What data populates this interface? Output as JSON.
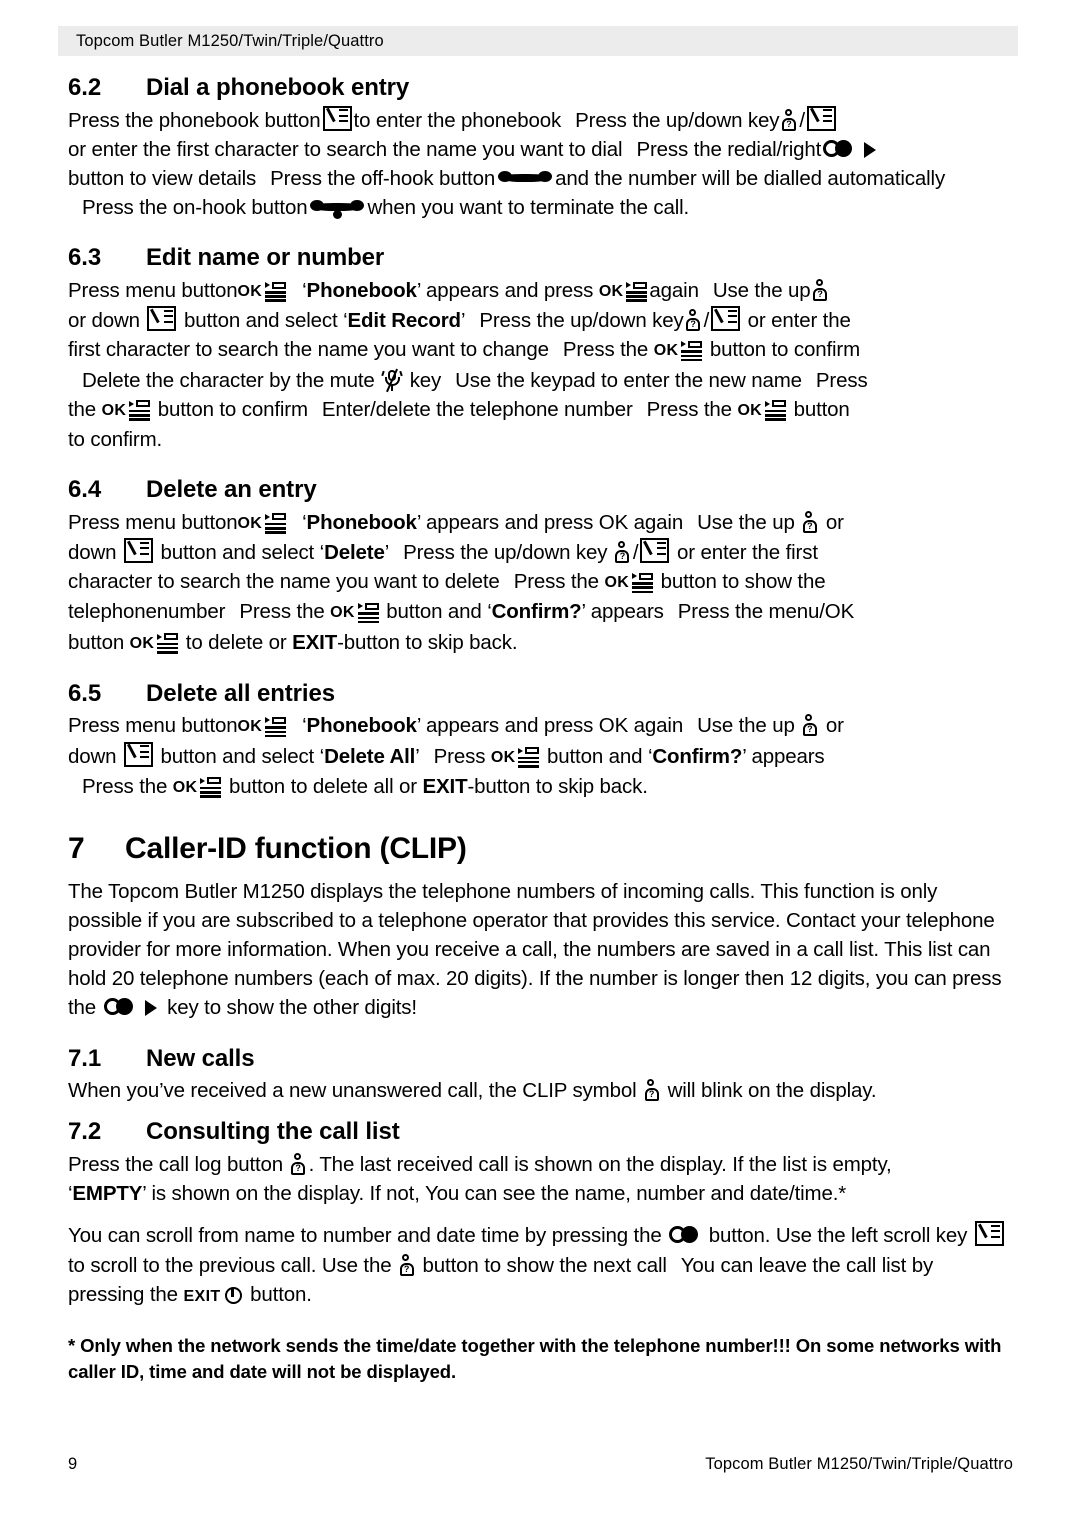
{
  "header": {
    "title": "Topcom Butler M1250/Twin/Triple/Quattro"
  },
  "footer": {
    "page_number": "9",
    "title": "Topcom Butler M1250/Twin/Triple/Quattro"
  },
  "icons": {
    "phonebook": "phonebook-icon",
    "up_key": "up-key-person-icon",
    "down_key": "down-key-phonebook-icon",
    "menu_ok": "menu-ok-icon",
    "redial": "redial-icon",
    "right_arrow": "right-arrow-icon",
    "off_hook": "off-hook-icon",
    "on_hook": "on-hook-icon",
    "mute": "mute-microphone-icon",
    "exit": "exit-power-icon",
    "ok_label": "OK",
    "exit_label": "EXIT",
    "person_question": "?"
  },
  "sections": [
    {
      "id": "6.2",
      "number": "6.2",
      "title": "Dial a phonebook entry",
      "text_parts": [
        "Press the phonebook button",
        "to enter the phonebook",
        "Press the up/down key",
        "/",
        "or enter the first character to search the name you want to dial",
        "Press the redial/right",
        "button to view details",
        "Press the off-hook button",
        "and the number will be dialled automatically",
        "Press the on-hook button",
        "when you want to terminate the call."
      ]
    },
    {
      "id": "6.3",
      "number": "6.3",
      "title": "Edit name or number",
      "text_parts": [
        "Press menu button",
        "‘Phonebook’ appears and press",
        "again",
        "Use the up",
        "or down",
        "button and select ‘Edit Record’",
        "Press the up/down key",
        "or enter the first character to search the name you want to change",
        "Press the",
        "button to confirm",
        "Delete the character by the mute",
        "key",
        "Use the keypad to enter the new name",
        "Press the",
        "button to confirm",
        "Enter/delete the telephone number",
        "Press the",
        "button to confirm."
      ]
    },
    {
      "id": "6.4",
      "number": "6.4",
      "title": "Delete an entry",
      "text_parts": [
        "Press menu button",
        "‘Phonebook’ appears and press OK again",
        "Use the up",
        "or down",
        "button and select ‘Delete’",
        "Press the up/down key",
        "or enter the first character to search the name you want to delete",
        "Press the",
        "button to show the telephonenumber",
        "Press the",
        "button and ‘Confirm?’ appears",
        "Press the menu/OK button",
        "to delete or EXIT-button to skip back."
      ]
    },
    {
      "id": "6.5",
      "number": "6.5",
      "title": "Delete all entries",
      "text_parts": [
        "Press menu button",
        "‘Phonebook’ appears and press OK again",
        "Use the up",
        "or down",
        "button and select ‘Delete All’",
        "Press",
        "button and ‘Confirm?’ appears",
        "Press the",
        "button to delete all or EXIT-button to skip back."
      ]
    },
    {
      "id": "7",
      "number": "7",
      "title": "Caller-ID function (CLIP)",
      "paragraph": "The Topcom Butler M1250 displays the telephone numbers of incoming calls. This function is only possible if you are subscribed to a telephone operator that provides this service. Contact your telephone provider for more information. When you receive a call, the numbers are saved in a call list. This list can hold 20 telephone numbers (each of max. 20 digits). If the number is longer then 12 digits, you can press the",
      "paragraph_tail": "key to show the other digits!"
    },
    {
      "id": "7.1",
      "number": "7.1",
      "title": "New calls",
      "text_head": "When you’ve received a new unanswered call, the CLIP symbol",
      "text_tail": "will blink on the display."
    },
    {
      "id": "7.2",
      "number": "7.2",
      "title": "Consulting the call list",
      "p1_head": "Press the call log button",
      "p1_tail": ". The last received call is shown on the display. If the list is empty, ‘EMPTY’ is shown on the display. If not, You can see the name, number and date/time.*",
      "p1_bold_empty": "EMPTY",
      "p2_a": "You can scroll from name to number and date time by pressing the",
      "p2_b": "button. Use the left scroll key",
      "p2_c": "to scroll to the previous call. Use the",
      "p2_d": "button to show the next call",
      "p2_e": "You can leave the call list by pressing the",
      "p2_f": "button."
    }
  ],
  "footnote": "* Only when the network sends the time/date together with the telephone number!!! On some networks with caller ID, time and date will not be displayed.",
  "bold_terms": {
    "phonebook": "Phonebook",
    "edit_record": "Edit Record",
    "delete": "Delete",
    "delete_all": "Delete All",
    "confirm": "Confirm?",
    "exit": "EXIT",
    "empty": "EMPTY"
  },
  "colors": {
    "header_bg": "#ececec",
    "text": "#000000",
    "page_bg": "#ffffff"
  }
}
